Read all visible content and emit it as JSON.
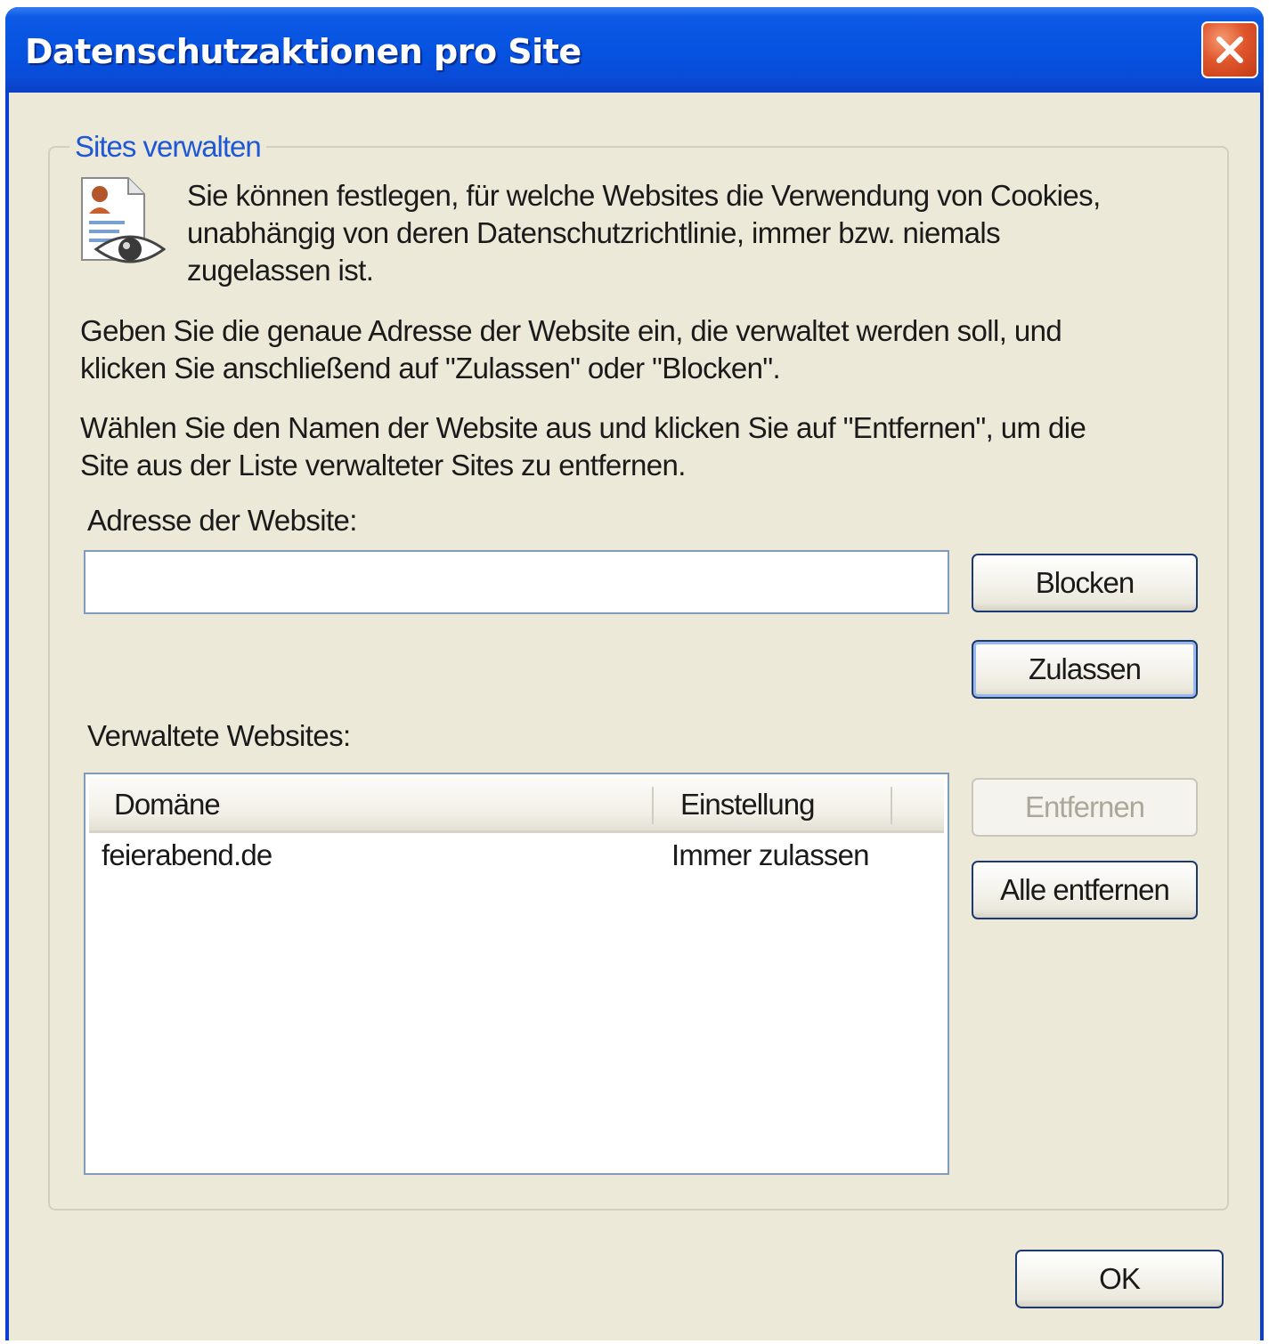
{
  "window": {
    "title": "Datenschutzaktionen pro Site"
  },
  "group": {
    "legend": "Sites verwalten",
    "intro_line1": "Sie können festlegen, für welche Websites die Verwendung von Cookies,",
    "intro_line2": "unabhängig von deren Datenschutzrichtlinie, immer bzw. niemals",
    "intro_line3": "zugelassen ist.",
    "instr1_line1": "Geben Sie die genaue Adresse der Website ein, die verwaltet werden soll, und",
    "instr1_line2": "klicken Sie anschließend auf \"Zulassen\" oder \"Blocken\".",
    "instr2_line1": "Wählen Sie den Namen der Website aus und klicken Sie auf \"Entfernen\", um die",
    "instr2_line2": "Site aus der Liste verwalteter Sites zu entfernen."
  },
  "address": {
    "label": "Adresse der Website:",
    "value": ""
  },
  "buttons": {
    "block": "Blocken",
    "allow": "Zulassen",
    "remove": "Entfernen",
    "remove_all": "Alle entfernen",
    "ok": "OK"
  },
  "managed": {
    "label": "Verwaltete Websites:",
    "columns": [
      "Domäne",
      "Einstellung"
    ],
    "rows": [
      {
        "domain": "feierabend.de",
        "setting": "Immer zulassen"
      }
    ]
  },
  "colors": {
    "titlebar": "#0552e0",
    "dialog_bg": "#ece9d8",
    "legend_blue": "#1e58d6",
    "close_red": "#e0562c"
  },
  "icons": {
    "close": "close-icon",
    "privacy": "privacy-report-icon"
  }
}
